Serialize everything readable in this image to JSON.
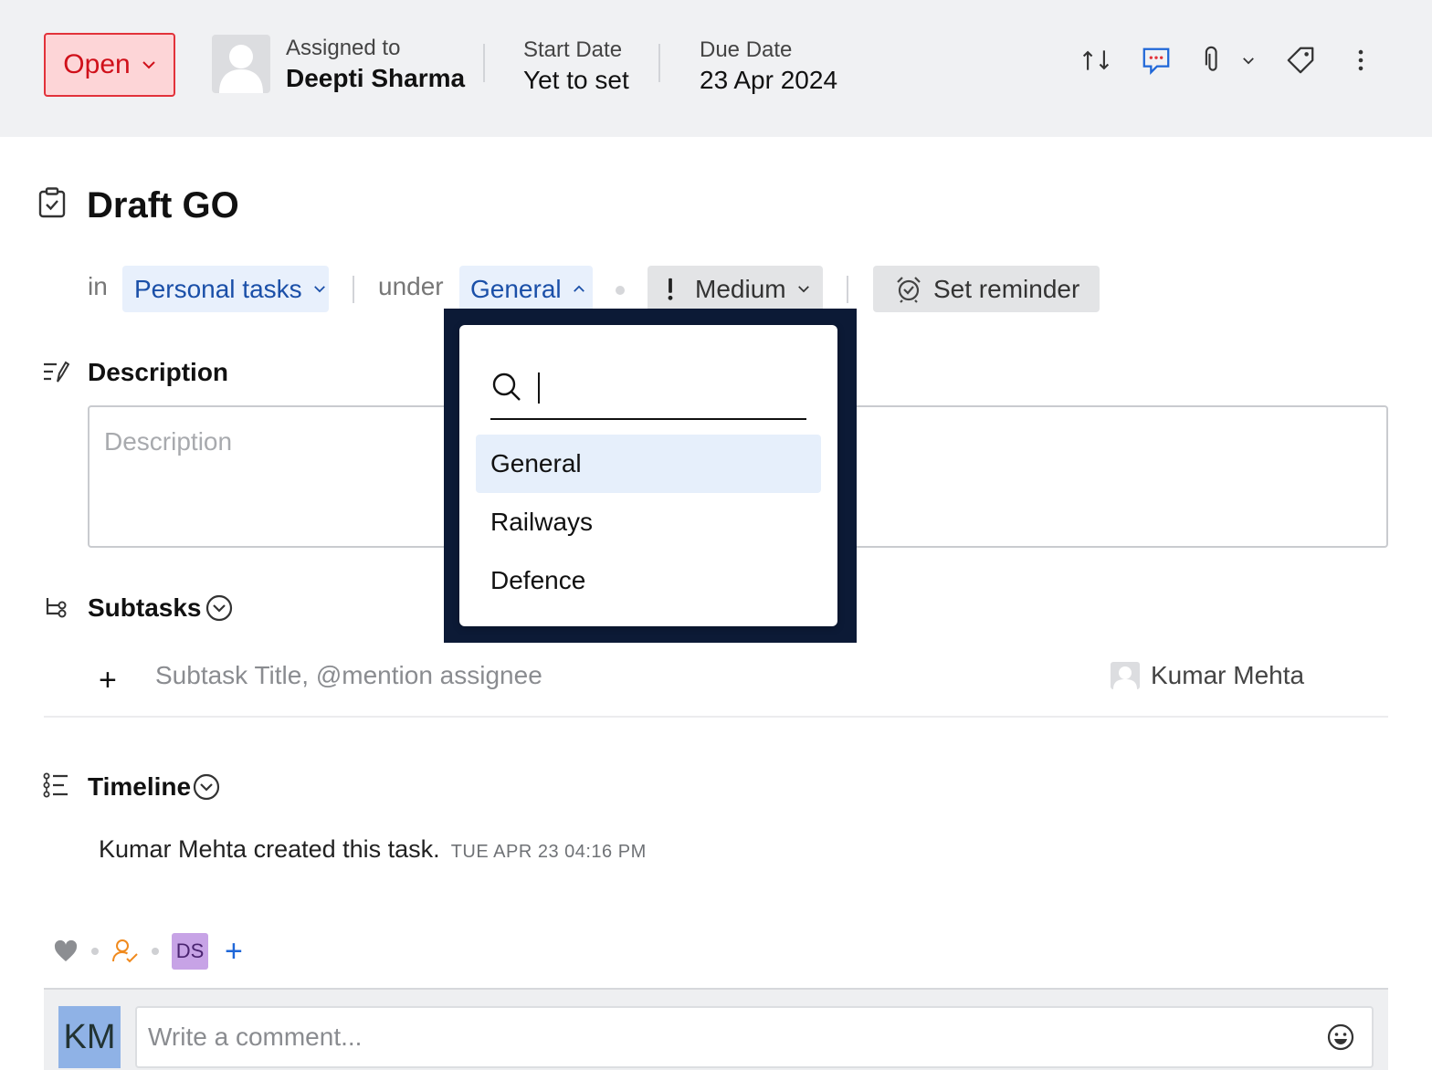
{
  "header": {
    "status": "Open",
    "assigned_label": "Assigned to",
    "assigned_name": "Deepti Sharma",
    "start_label": "Start Date",
    "start_value": "Yet to set",
    "due_label": "Due Date",
    "due_value": "23 Apr 2024",
    "icons": [
      "swap-icon",
      "comment-icon",
      "attachment-icon",
      "chevron-down-icon",
      "tag-icon",
      "more-icon"
    ]
  },
  "task": {
    "title": "Draft GO"
  },
  "meta": {
    "in_label": "in",
    "project": "Personal tasks",
    "under_label": "under",
    "tasklist": "General",
    "priority": "Medium",
    "reminder": "Set reminder"
  },
  "description": {
    "title": "Description",
    "placeholder": "Description"
  },
  "subtasks": {
    "title": "Subtasks",
    "input_placeholder": "Subtask Title, @mention assignee",
    "assignee": "Kumar Mehta"
  },
  "timeline": {
    "title": "Timeline",
    "actor": "Kumar Mehta",
    "action": " created this task.",
    "timestamp": "TUE APR 23 04:16 PM"
  },
  "reactions": {
    "follower_initials": "DS"
  },
  "comment": {
    "avatar_initials": "KM",
    "placeholder": "Write a comment..."
  },
  "dropdown": {
    "search_value": "",
    "items": [
      "General",
      "Railways",
      "Defence"
    ],
    "selected": "General"
  },
  "colors": {
    "status_red": "#d0101a",
    "accent_blue": "#1a4fa8",
    "dropdown_frame": "#0c1a36"
  }
}
